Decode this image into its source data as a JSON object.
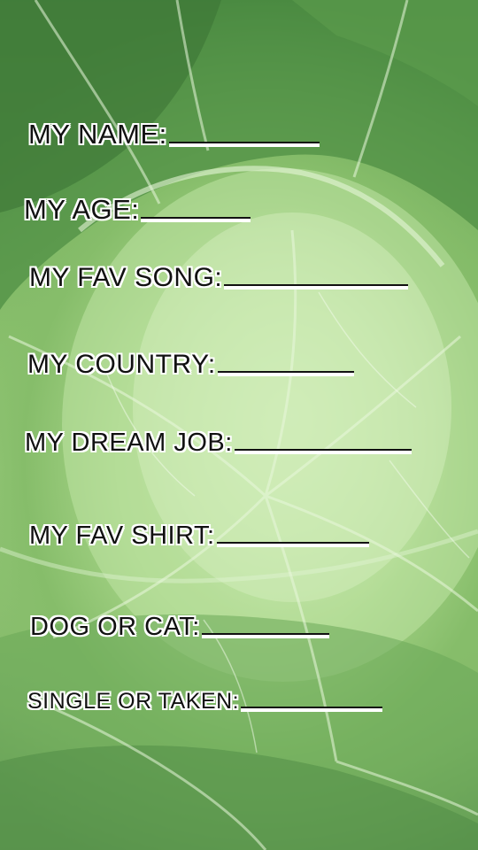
{
  "background": {
    "subject": "cabbage-leaves-photo",
    "colors": {
      "dark_leaf": "#3f7d3a",
      "mid_leaf": "#8cc26e",
      "light_center": "#d8f2c4"
    }
  },
  "form": {
    "fields": [
      {
        "label": "MY NAME:"
      },
      {
        "label": "MY AGE:"
      },
      {
        "label": "MY FAV SONG:"
      },
      {
        "label": "MY COUNTRY:"
      },
      {
        "label": "MY DREAM JOB:"
      },
      {
        "label": "MY FAV SHIRT:"
      },
      {
        "label": "DOG OR CAT:"
      },
      {
        "label": "SINGLE OR TAKEN:"
      }
    ],
    "text_color": "#111111",
    "outline_color": "#ffffff"
  }
}
